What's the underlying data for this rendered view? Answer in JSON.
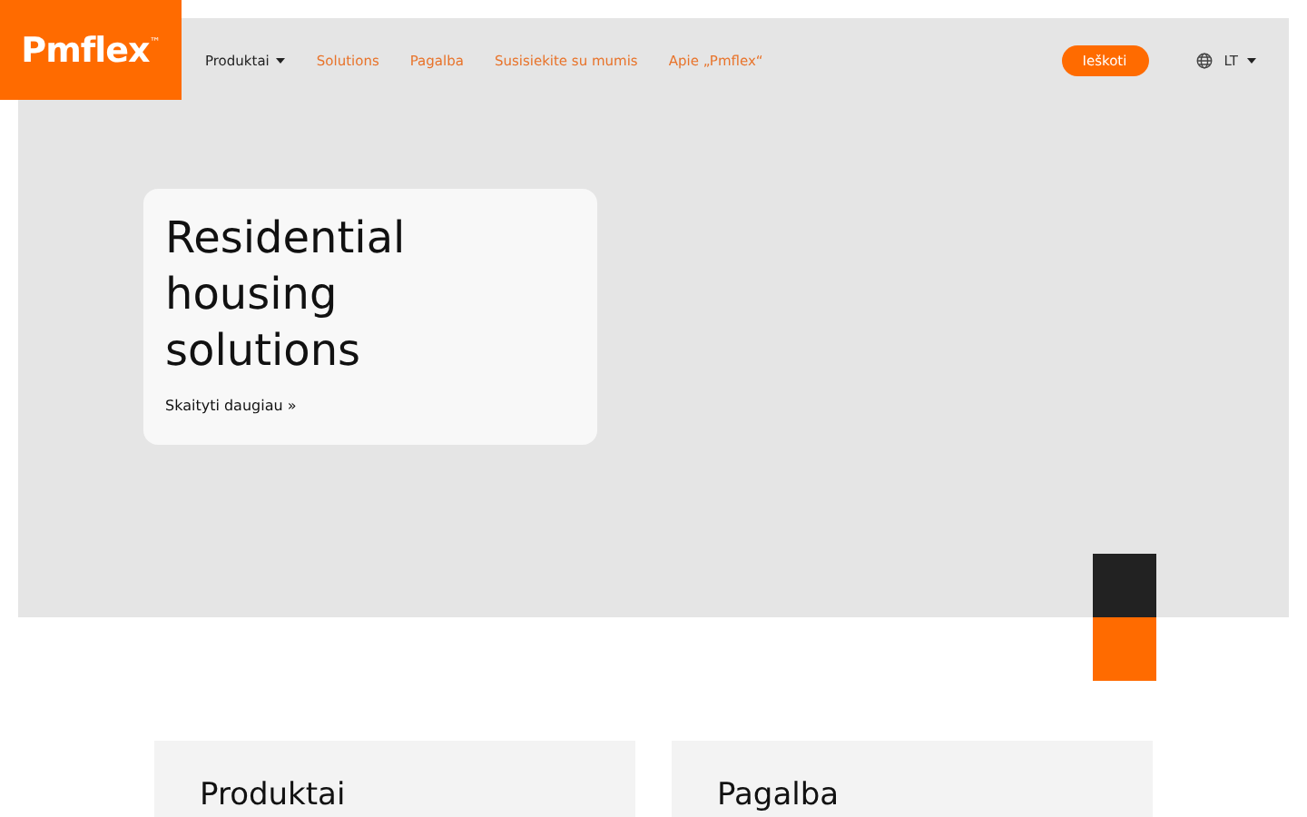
{
  "logo": {
    "text": "Pmflex",
    "mark": "™"
  },
  "nav": [
    {
      "label": "Produktai",
      "kind": "dropdown"
    },
    {
      "label": "Solutions",
      "kind": "link"
    },
    {
      "label": "Pagalba",
      "kind": "link"
    },
    {
      "label": "Susisiekite su mumis",
      "kind": "link"
    },
    {
      "label": "Apie „Pmflex“",
      "kind": "link"
    }
  ],
  "search_button": "Ieškoti",
  "language": "LT",
  "hero": {
    "title": "Residential housing solutions",
    "link": "Skaityti daugiau »"
  },
  "cards": [
    {
      "title": "Produktai"
    },
    {
      "title": "Pagalba"
    }
  ]
}
